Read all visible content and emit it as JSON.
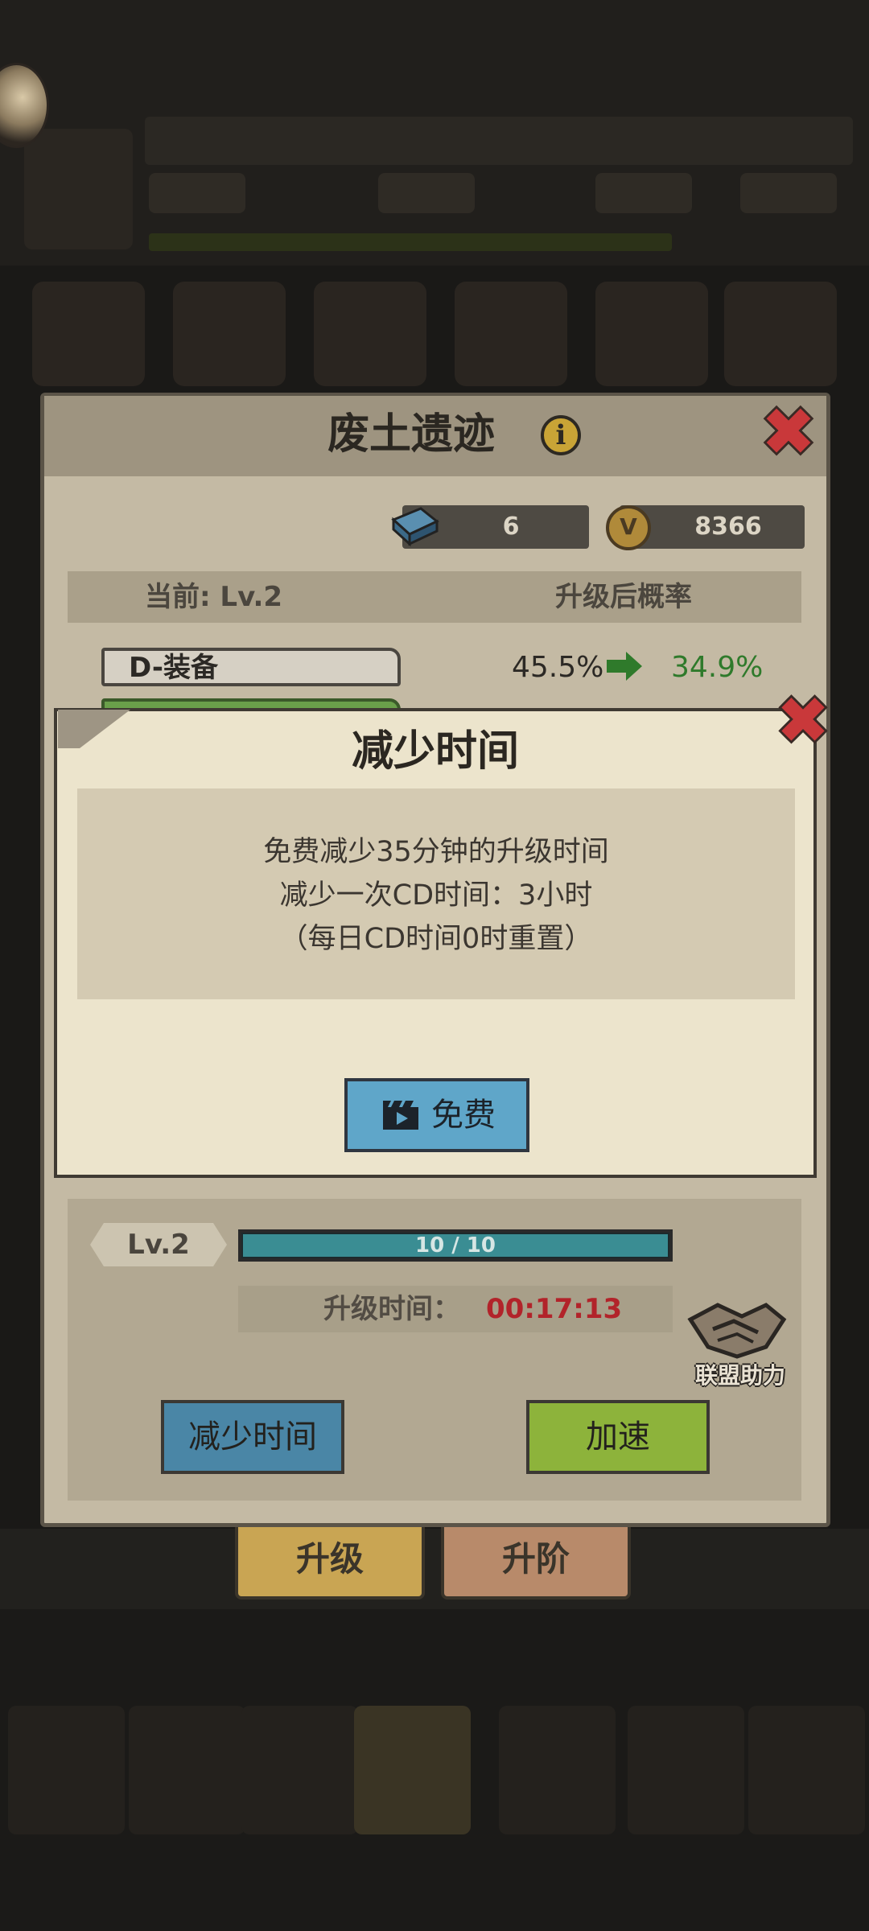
{
  "panel": {
    "title": "废土遗迹",
    "resources": {
      "gems": "6",
      "coins": "8366"
    },
    "stats_header": {
      "current_label": "当前: Lv.2",
      "after_label": "升级后概率"
    },
    "equipment_row": {
      "name": "D-装备",
      "current_rate": "45.5%",
      "next_rate": "34.9%"
    },
    "level_tag": "Lv.2",
    "progress": {
      "text": "10 / 10",
      "value": 1.0
    },
    "upgrade_time": {
      "label": "升级时间：",
      "value": "00:17:13"
    },
    "alliance_help_label": "联盟助力",
    "reduce_time_button": "减少时间",
    "speed_up_button": "加速"
  },
  "tabs": [
    {
      "label": "升级",
      "active": true
    },
    {
      "label": "升阶",
      "active": false
    }
  ],
  "modal": {
    "title": "减少时间",
    "lines": [
      "免费减少35分钟的升级时间",
      "减少一次CD时间：3小时",
      "（每日CD时间0时重置）"
    ],
    "free_button": "免费"
  },
  "colors": {
    "timer_red": "#b2232a",
    "rate_green": "#2f7a2b",
    "reduce_button": "#4a86a6",
    "speed_button": "#8db33b",
    "free_button": "#5fa6c9",
    "close_red": "#c9383a"
  }
}
